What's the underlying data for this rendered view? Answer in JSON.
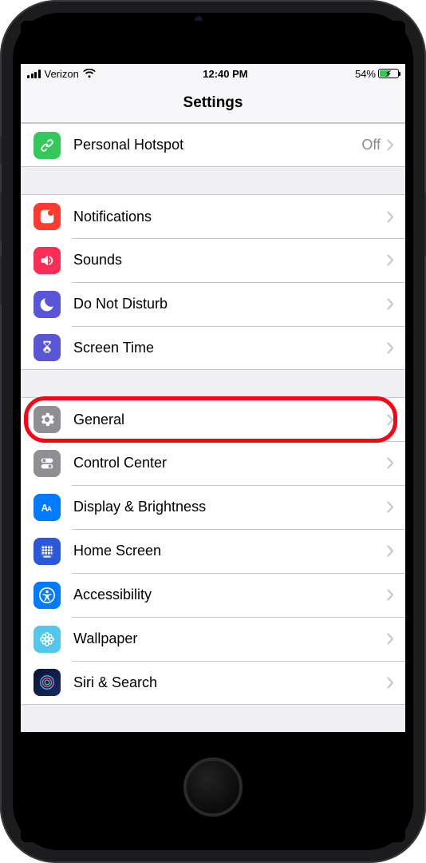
{
  "status": {
    "carrier": "Verizon",
    "time": "12:40 PM",
    "battery_pct": "54%"
  },
  "header": {
    "title": "Settings"
  },
  "groups": [
    {
      "rows": [
        {
          "id": "personal-hotspot",
          "label": "Personal Hotspot",
          "value": "Off",
          "icon": "link",
          "bg": "bg-green"
        }
      ]
    },
    {
      "rows": [
        {
          "id": "notifications",
          "label": "Notifications",
          "icon": "notification",
          "bg": "bg-red"
        },
        {
          "id": "sounds",
          "label": "Sounds",
          "icon": "speaker",
          "bg": "bg-pink"
        },
        {
          "id": "do-not-disturb",
          "label": "Do Not Disturb",
          "icon": "moon",
          "bg": "bg-purple"
        },
        {
          "id": "screen-time",
          "label": "Screen Time",
          "icon": "hourglass",
          "bg": "bg-purple"
        }
      ]
    },
    {
      "rows": [
        {
          "id": "general",
          "label": "General",
          "icon": "gear",
          "bg": "bg-gray",
          "highlighted": true
        },
        {
          "id": "control-center",
          "label": "Control Center",
          "icon": "toggles",
          "bg": "bg-gray"
        },
        {
          "id": "display-brightness",
          "label": "Display & Brightness",
          "icon": "text-size",
          "bg": "bg-blue"
        },
        {
          "id": "home-screen",
          "label": "Home Screen",
          "icon": "grid",
          "bg": "bg-homescreen"
        },
        {
          "id": "accessibility",
          "label": "Accessibility",
          "icon": "accessibility",
          "bg": "bg-blue"
        },
        {
          "id": "wallpaper",
          "label": "Wallpaper",
          "icon": "flower",
          "bg": "bg-cyan"
        },
        {
          "id": "siri-search",
          "label": "Siri & Search",
          "icon": "siri",
          "bg": "bg-siri"
        }
      ]
    }
  ]
}
